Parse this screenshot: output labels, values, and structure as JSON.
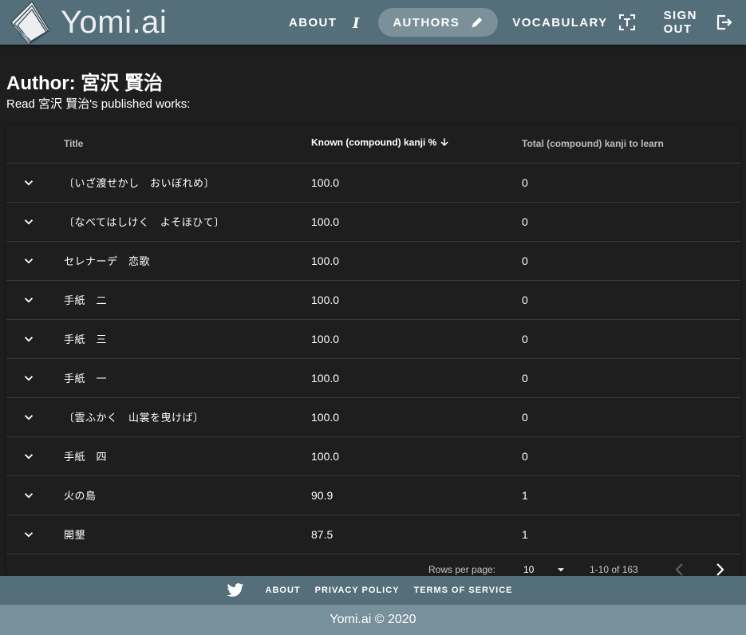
{
  "brand": {
    "name": "Yomi.ai",
    "logo_icon": "books-icon"
  },
  "nav": {
    "items": [
      {
        "label": "ABOUT",
        "icon": "info-icon",
        "active": false
      },
      {
        "label": "AUTHORS",
        "icon": "pen-icon",
        "active": true
      },
      {
        "label": "VOCABULARY",
        "icon": "text-recognition-icon",
        "active": false
      },
      {
        "label": "SIGN OUT",
        "icon": "logout-icon",
        "active": false
      }
    ]
  },
  "page": {
    "title": "Author: 宮沢 賢治",
    "subtitle": "Read 宮沢 賢治's published works:"
  },
  "table": {
    "headers": {
      "title": "Title",
      "known": "Known (compound) kanji %",
      "total": "Total (compound) kanji to learn"
    },
    "sort": {
      "column": "known",
      "direction": "descending",
      "icon": "arrow-down-icon"
    },
    "rows": [
      {
        "title": "〔いざ渡せかし　おいぼれめ〕",
        "known": "100.0",
        "total": "0"
      },
      {
        "title": "〔なべてはしけく　よそほひて〕",
        "known": "100.0",
        "total": "0"
      },
      {
        "title": "セレナーデ　恋歌",
        "known": "100.0",
        "total": "0"
      },
      {
        "title": "手紙　二",
        "known": "100.0",
        "total": "0"
      },
      {
        "title": "手紙　三",
        "known": "100.0",
        "total": "0"
      },
      {
        "title": "手紙　一",
        "known": "100.0",
        "total": "0"
      },
      {
        "title": "〔雲ふかく　山裳を曳けば〕",
        "known": "100.0",
        "total": "0"
      },
      {
        "title": "手紙　四",
        "known": "100.0",
        "total": "0"
      },
      {
        "title": "火の島",
        "known": "90.9",
        "total": "1"
      },
      {
        "title": "開墾",
        "known": "87.5",
        "total": "1"
      }
    ],
    "footer": {
      "rows_per_page_label": "Rows per page:",
      "rows_per_page_value": "10",
      "page_range": "1-10 of 163"
    }
  },
  "footer": {
    "twitter_icon": "twitter-icon",
    "links": [
      "ABOUT",
      "PRIVACY POLICY",
      "TERMS OF SERVICE"
    ],
    "copyright": "Yomi.ai © 2020"
  },
  "colors": {
    "appbar": "#546e7a",
    "background": "#1e1e1e",
    "copyright_bar": "#78909c"
  }
}
